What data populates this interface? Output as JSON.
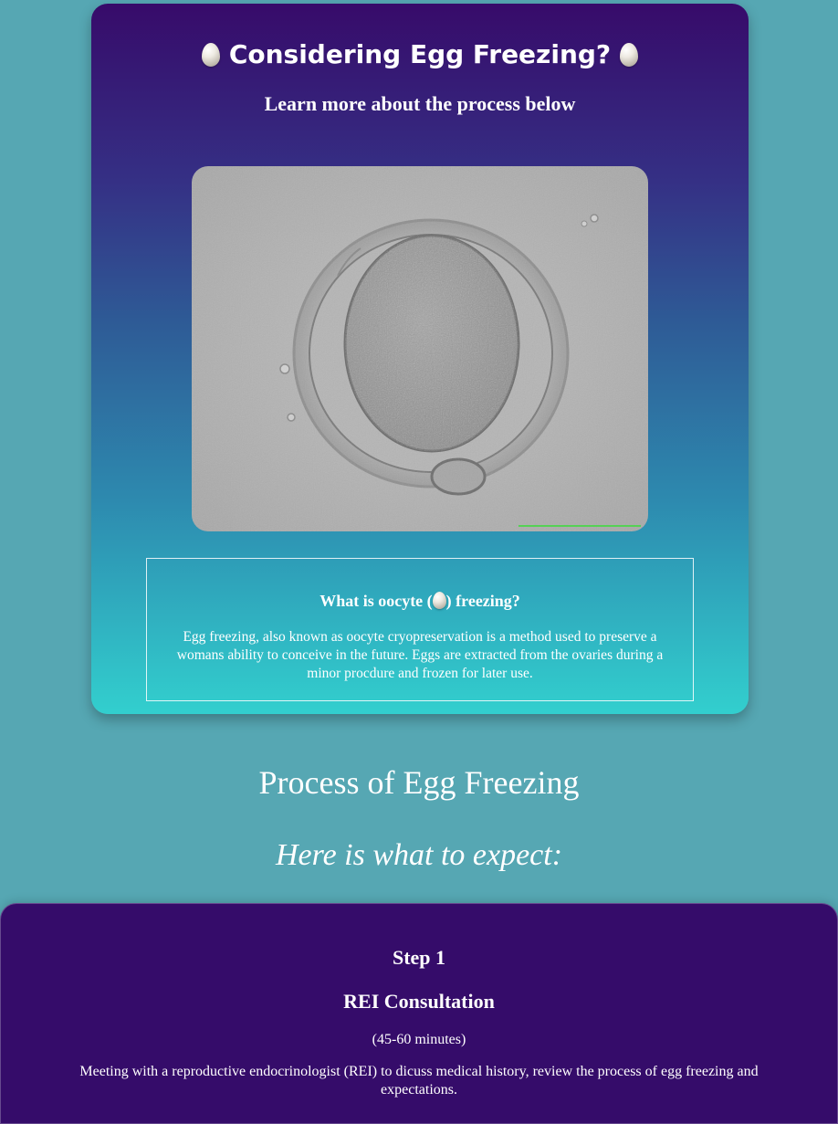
{
  "hero": {
    "title": "Considering Egg Freezing?",
    "subtitle": "Learn more about the process below",
    "image_description_label": "oocyte-micrograph"
  },
  "info": {
    "heading_prefix": "What is oocyte (",
    "heading_suffix": ") freezing?",
    "text": "Egg freezing, also known as oocyte cryopreservation is a method used to preserve a womans ability to conceive in the future. Eggs are extracted from the ovaries during a minor procdure and frozen for later use."
  },
  "process": {
    "title": "Process of Egg Freezing",
    "subtitle": "Here is what to expect:"
  },
  "steps": [
    {
      "number": "Step 1",
      "title": "REI Consultation",
      "duration": "(45-60 minutes)",
      "description": "Meeting with a reproductive endocrinologist (REI) to dicuss medical history, review the process of egg freezing and expectations."
    }
  ],
  "colors": {
    "page_background": "#56a7b3",
    "hero_gradient_top": "#370b6a",
    "hero_gradient_bottom": "#32cfce",
    "step_card_background": "#350c6a",
    "text": "#ffffff"
  },
  "icons": {
    "title_left": "egg-icon",
    "title_right": "egg-icon",
    "info_inline": "egg-icon"
  }
}
